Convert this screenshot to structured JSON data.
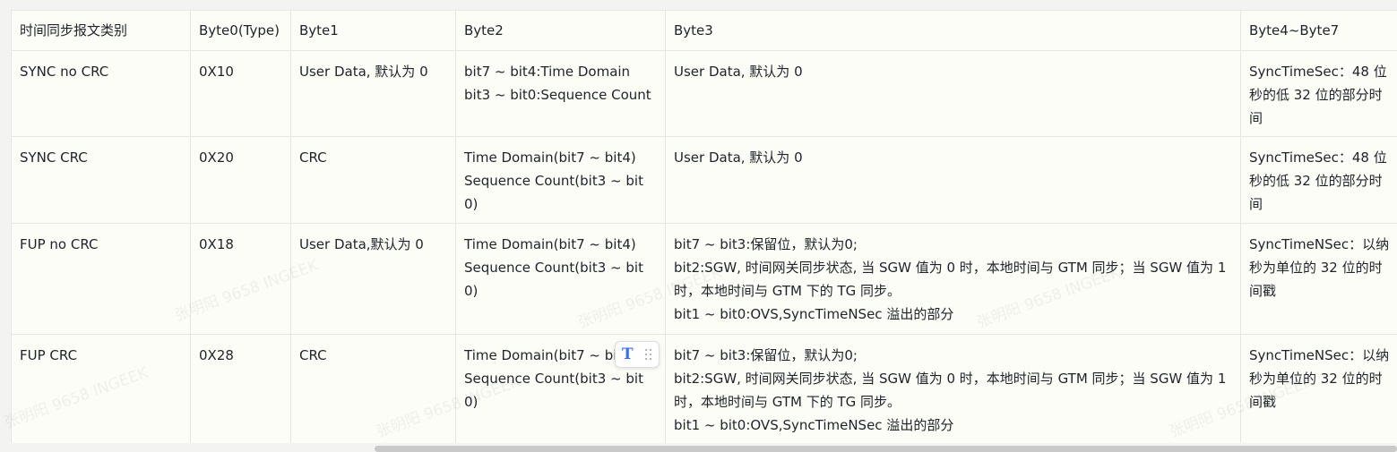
{
  "table": {
    "headers": [
      "时间同步报文类别",
      "Byte0(Type)",
      "Byte1",
      "Byte2",
      "Byte3",
      "Byte4~Byte7"
    ],
    "rows": [
      [
        "SYNC no CRC",
        "0X10",
        "User Data, 默认为 0",
        "bit7 ~ bit4:Time Domain\nbit3 ~ bit0:Sequence Count",
        "User Data, 默认为 0",
        "SyncTimeSec：48 位秒的低 32 位的部分时间"
      ],
      [
        "SYNC CRC",
        "0X20",
        "CRC",
        "Time Domain(bit7 ~ bit4)\nSequence Count(bit3 ~ bit0)",
        "User Data, 默认为 0",
        "SyncTimeSec：48 位秒的低 32 位的部分时间"
      ],
      [
        "FUP no CRC",
        "0X18",
        "User Data,默认为 0",
        "Time Domain(bit7 ~ bit4)\nSequence Count(bit3 ~ bit0)",
        "bit7 ~ bit3:保留位，默认为0;\nbit2:SGW, 时间网关同步状态, 当 SGW 值为 0 时，本地时间与 GTM 同步；当 SGW 值为 1 时，本地时间与 GTM 下的 TG 同步。\nbit1 ~ bit0:OVS,SyncTimeNSec 溢出的部分",
        "SyncTimeNSec：以纳秒为单位的 32 位的时间戳"
      ],
      [
        "FUP CRC",
        "0X28",
        "CRC",
        "Time Domain(bit7 ~ bit4)\nSequence Count(bit3 ~ bit0)",
        "bit7 ~ bit3:保留位，默认为0;\nbit2:SGW, 时间网关同步状态, 当 SGW 值为 0 时，本地时间与 GTM 同步；当 SGW 值为 1 时，本地时间与 GTM 下的 TG 同步。\nbit1 ~ bit0:OVS,SyncTimeNSec 溢出的部分",
        "SyncTimeNSec：以纳秒为单位的 32 位的时间戳"
      ]
    ]
  },
  "watermark_text": "张明阳 9658 INGEEK",
  "icons": {
    "text_format": "T",
    "text_format_icon": "text-format-icon",
    "drag_handle_icon": "drag-handle-icon"
  },
  "colors": {
    "accent": "#3370ff",
    "cell_background": "#fdfdf8",
    "border": "#e6e6e3"
  }
}
